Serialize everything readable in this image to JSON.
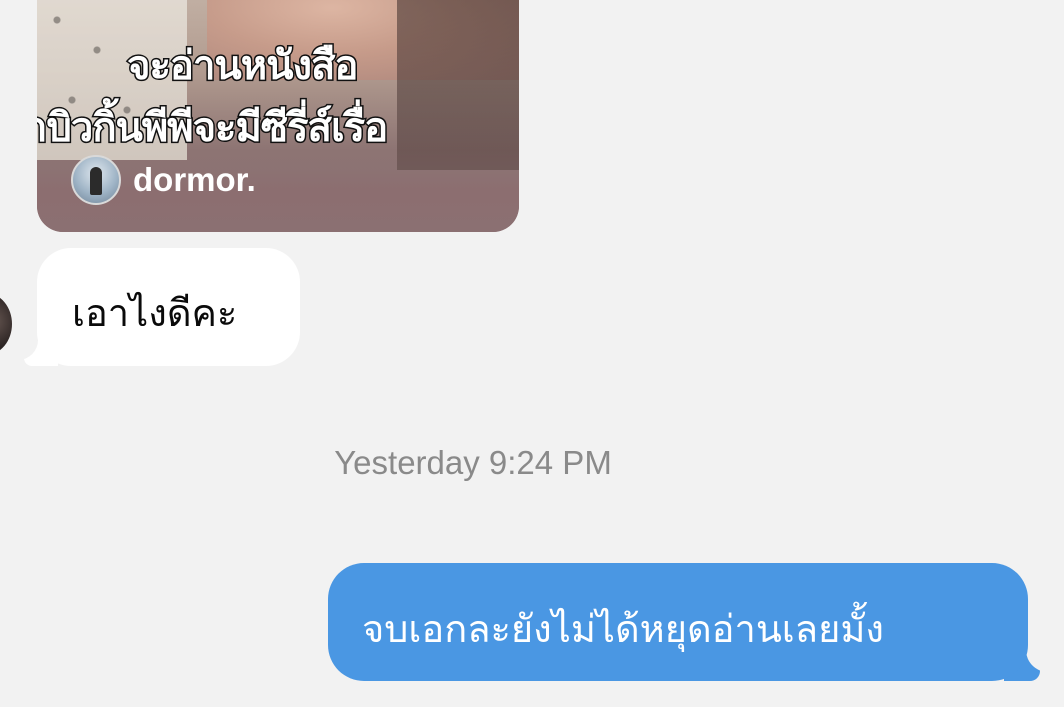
{
  "shared_post": {
    "caption_lines": [
      "จะอ่านหนังสือ",
      "าบิวกิ้นพีพีจะมีซีรี่ส์เรื่อ"
    ],
    "author": "dormor.",
    "author_avatar_icon": "profile-avatar"
  },
  "messages": [
    {
      "direction": "received",
      "text": "เอาไงดีคะ",
      "sender_avatar_icon": "profile-avatar"
    },
    {
      "direction": "sent",
      "text": "จบเอกละยังไม่ได้หยุดอ่านเลยมั้ง"
    }
  ],
  "timestamp": "Yesterday 9:24 PM",
  "colors": {
    "background": "#f2f2f2",
    "received_bubble": "#ffffff",
    "sent_bubble": "#4a97e3",
    "timestamp_text": "#8a8a8a"
  }
}
